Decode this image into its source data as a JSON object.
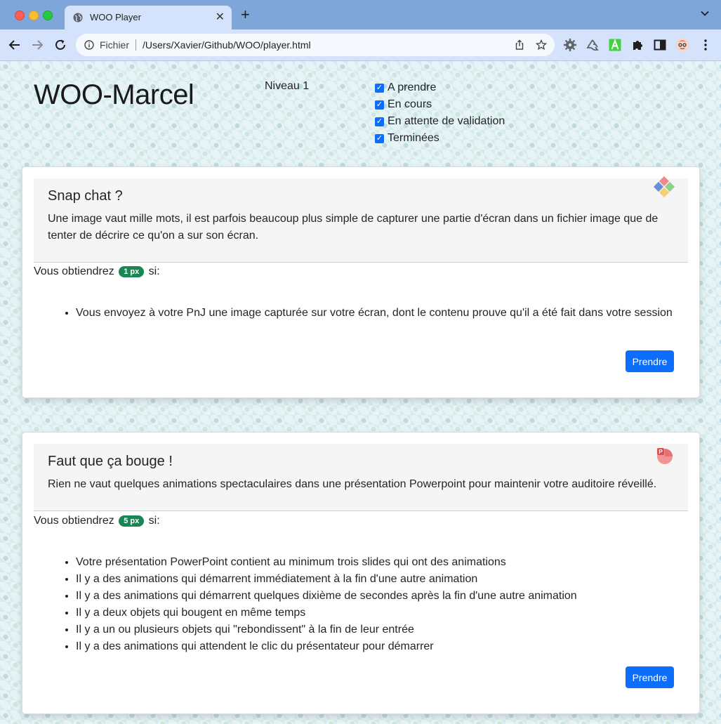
{
  "browser": {
    "tab_title": "WOO Player",
    "new_tab": "+",
    "close_tab": "✕",
    "scheme_label": "Fichier",
    "url": "/Users/Xavier/Github/WOO/player.html"
  },
  "header": {
    "player_name": "WOO-Marcel",
    "level": "Niveau 1",
    "filters": [
      {
        "label": "A prendre",
        "checked": true
      },
      {
        "label": "En cours",
        "checked": true
      },
      {
        "label": "En attente de validation",
        "checked": true
      },
      {
        "label": "Terminées",
        "checked": true
      }
    ]
  },
  "quests": [
    {
      "title": "Snap chat ?",
      "description": "Une image vaut mille mots, il est parfois beaucoup plus simple de capturer une partie d'écran dans un fichier image que de tenter de décrire ce qu'on a sur son écran.",
      "reward_prefix": "Vous obtiendrez",
      "reward": "1 px",
      "reward_suffix": "si:",
      "conditions": [
        "Vous envoyez à votre PnJ une image capturée sur votre écran, dont le contenu prouve qu'il a été fait dans votre session"
      ],
      "button": "Prendre",
      "icon": "app-diamond-icon"
    },
    {
      "title": "Faut que ça bouge !",
      "description": "Rien ne vaut quelques animations spectaculaires dans une présentation Powerpoint pour maintenir votre auditoire réveillé.",
      "reward_prefix": "Vous obtiendrez",
      "reward": "5 px",
      "reward_suffix": "si:",
      "conditions": [
        "Votre présentation PowerPoint contient au minimum trois slides qui ont des animations",
        "Il y a des animations qui démarrent immédiatement à la fin d'une autre animation",
        "Il y a des animations qui démarrent quelques dixième de secondes après la fin d'une autre animation",
        "Il y a deux objets qui bougent en même temps",
        "Il y a un ou plusieurs objets qui \"rebondissent\" à la fin de leur entrée",
        "Il y a des animations qui attendent le clic du présentateur pour démarrer"
      ],
      "button": "Prendre",
      "icon": "powerpoint-icon"
    }
  ]
}
